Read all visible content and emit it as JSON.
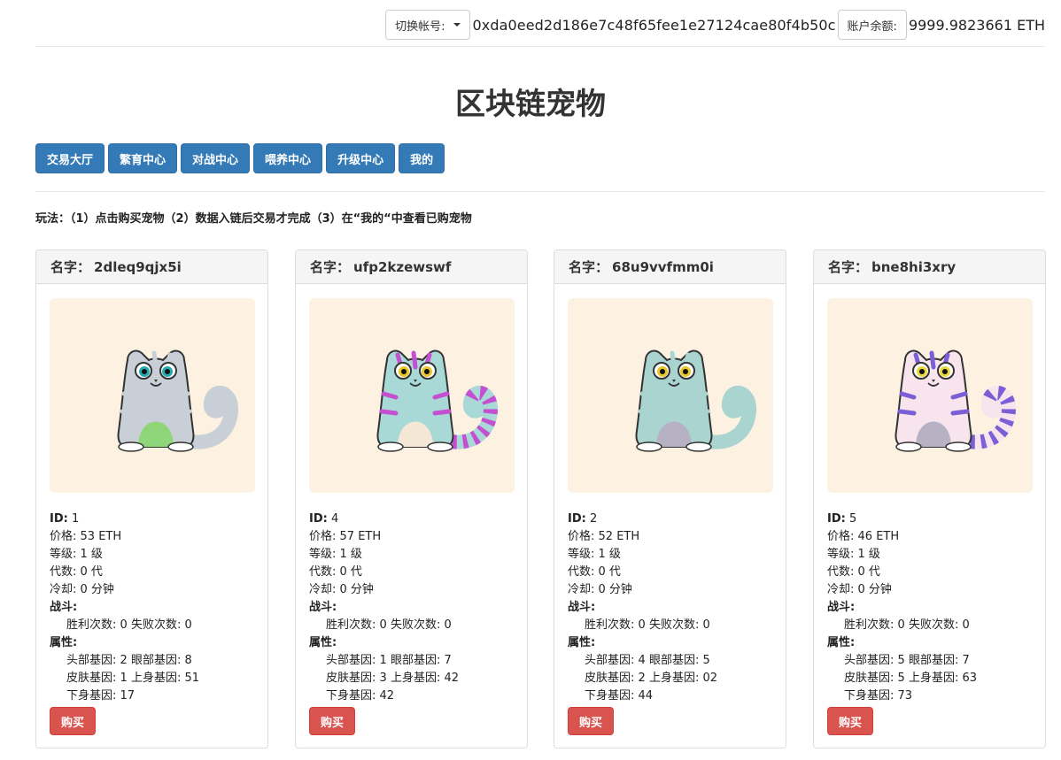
{
  "header": {
    "switch_label": "切换帐号:",
    "address": "0xda0eed2d186e7c48f65fee1e27124cae80f4b50c",
    "balance_label": "账户余额:",
    "balance_value": "9999.9823661 ETH"
  },
  "title": "区块链宠物",
  "nav": [
    "交易大厅",
    "繁育中心",
    "对战中心",
    "喂养中心",
    "升级中心",
    "我的"
  ],
  "instructions": "玩法：（1）点击购买宠物（2）数据入链后交易才完成（3）在“我的“中查看已购宠物",
  "labels": {
    "name": "名字：",
    "id": "ID:",
    "price": "价格:",
    "level": "等级:",
    "generation": "代数:",
    "cooldown": "冷却:",
    "battle": "战斗:",
    "wins": "胜利次数:",
    "losses": "失败次数:",
    "attributes": "属性:",
    "head_gene": "头部基因:",
    "eye_gene": "眼部基因:",
    "skin_gene": "皮肤基因:",
    "upper_gene": "上身基因:",
    "lower_gene": "下身基因:",
    "buy": "购买"
  },
  "pets": [
    {
      "name": "2dleq9qjx5i",
      "id": "1",
      "price": "53 ETH",
      "level": "1 级",
      "generation": "0 代",
      "cooldown": "0 分钟",
      "wins": "0",
      "losses": "0",
      "head": "2",
      "eye": "8",
      "skin": "1",
      "upper": "51",
      "lower": "17",
      "colors": {
        "body": "#c9cfd6",
        "belly": "#8fd67a",
        "stripe": "#c9cfd6",
        "eye": "#27a9b0"
      }
    },
    {
      "name": "ufp2kzewswf",
      "id": "4",
      "price": "57 ETH",
      "level": "1 级",
      "generation": "0 代",
      "cooldown": "0 分钟",
      "wins": "0",
      "losses": "0",
      "head": "1",
      "eye": "7",
      "skin": "3",
      "upper": "42",
      "lower": "42",
      "colors": {
        "body": "#a9d9d6",
        "belly": "#f4e7d6",
        "stripe": "#c44fd0",
        "eye": "#e8c62a"
      }
    },
    {
      "name": "68u9vvfmm0i",
      "id": "2",
      "price": "52 ETH",
      "level": "1 级",
      "generation": "0 代",
      "cooldown": "0 分钟",
      "wins": "0",
      "losses": "0",
      "head": "4",
      "eye": "5",
      "skin": "2",
      "upper": "02",
      "lower": "44",
      "colors": {
        "body": "#a9d4d0",
        "belly": "#b6b2c3",
        "stripe": "#a9d4d0",
        "eye": "#e8c62a"
      }
    },
    {
      "name": "bne8hi3xry",
      "id": "5",
      "price": "46 ETH",
      "level": "1 级",
      "generation": "0 代",
      "cooldown": "0 分钟",
      "wins": "0",
      "losses": "0",
      "head": "5",
      "eye": "7",
      "skin": "5",
      "upper": "63",
      "lower": "73",
      "colors": {
        "body": "#f7e4ec",
        "belly": "#b6b2c3",
        "stripe": "#7b5fd6",
        "eye": "#e8d73a"
      }
    }
  ]
}
